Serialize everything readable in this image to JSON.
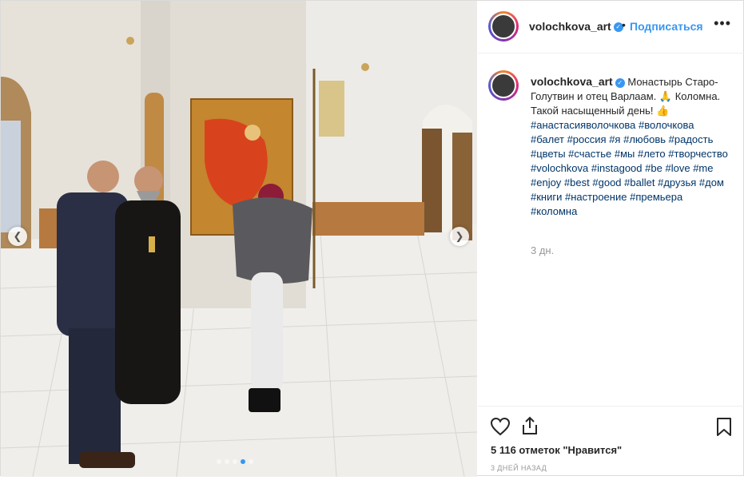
{
  "post": {
    "username": "volochkova_art",
    "follow_label": "Подписаться",
    "separator": "•",
    "more_label": "•••",
    "caption_text": "Монастырь Старо-Голутвин и отец Варлаам. 🙏 Коломна. Такой насыщенный день! 👍",
    "hashtags": [
      "#анастасияволочкова",
      "#волочкова",
      "#балет",
      "#россия",
      "#я",
      "#любовь",
      "#радость",
      "#цветы",
      "#счастье",
      "#мы",
      "#лето",
      "#творчество",
      "#volochkova",
      "#instagood",
      "#be",
      "#love",
      "#me",
      "#enjoy",
      "#best",
      "#good",
      "#ballet",
      "#друзья",
      "#дом",
      "#книги",
      "#настроение",
      "#премьера",
      "#коломна"
    ],
    "caption_age": "3 дн.",
    "likes": "5 116 отметок \"Нравится\"",
    "date": "3 ДНЕЙ НАЗАД",
    "carousel": {
      "total": 5,
      "active": 4
    }
  },
  "icons": {
    "prev": "chevron-left-icon",
    "next": "chevron-right-icon",
    "like": "heart-icon",
    "share": "share-icon",
    "save": "bookmark-icon",
    "verified": "verified-badge-icon"
  },
  "colors": {
    "accent": "#3897f0",
    "hashtag": "#003569",
    "muted": "#999999"
  }
}
